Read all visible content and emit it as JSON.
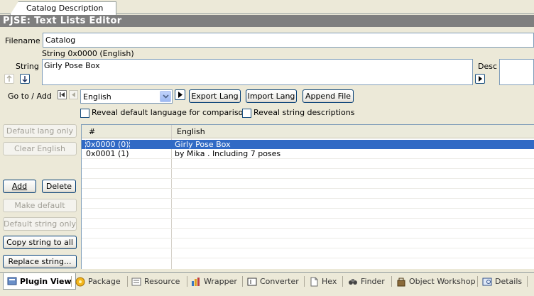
{
  "doc_tab": {
    "label": "Catalog Description"
  },
  "title": "PJSE: Text Lists Editor",
  "filename": {
    "label": "Filename",
    "value": "Catalog"
  },
  "string": {
    "header": "String 0x0000 (English)",
    "label": "String",
    "value": "Girly Pose Box",
    "desc_label": "Desc"
  },
  "goto": {
    "label": "Go to / Add",
    "language": "English",
    "export_label": "Export Lang",
    "import_label": "Import Lang",
    "append_label": "Append File"
  },
  "options": {
    "reveal_default": "Reveal default language for comparison",
    "reveal_desc": "Reveal string descriptions"
  },
  "buttons": {
    "default_lang_only": "Default lang only",
    "clear_english": "Clear English",
    "add": "Add",
    "delete": "Delete",
    "make_default": "Make default",
    "default_string_only": "Default string only",
    "copy_string_to_all": "Copy string to all",
    "replace_string": "Replace string..."
  },
  "grid": {
    "columns": [
      "#",
      "English"
    ],
    "rows": [
      {
        "id": "0x0000 (0)",
        "text": "Girly Pose Box",
        "selected": true
      },
      {
        "id": "0x0001 (1)",
        "text": "by Mika . Including 7 poses",
        "selected": false
      }
    ]
  },
  "bottom_tabs": [
    {
      "label": "Plugin View",
      "icon": "plugin-view-icon",
      "active": true
    },
    {
      "label": "Package",
      "icon": "package-icon",
      "active": false
    },
    {
      "label": "Resource",
      "icon": "resource-icon",
      "active": false
    },
    {
      "label": "Wrapper",
      "icon": "wrapper-icon",
      "active": false
    },
    {
      "label": "Converter",
      "icon": "converter-icon",
      "active": false
    },
    {
      "label": "Hex",
      "icon": "hex-icon",
      "active": false
    },
    {
      "label": "Finder",
      "icon": "finder-icon",
      "active": false
    },
    {
      "label": "Object Workshop",
      "icon": "object-workshop-icon",
      "active": false
    },
    {
      "label": "Details",
      "icon": "details-icon",
      "active": false
    }
  ],
  "colors": {
    "selection": "#316ac5",
    "titlebar": "#7f7f7f",
    "chrome": "#ece9d8",
    "border": "#7f9db9"
  }
}
